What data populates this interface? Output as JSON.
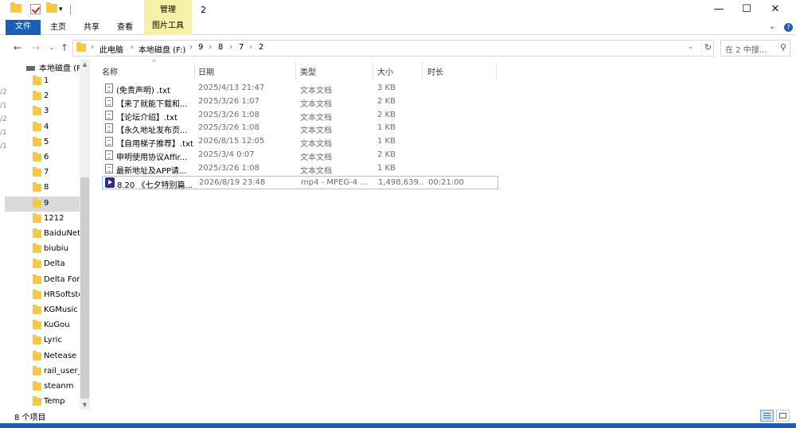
{
  "title_bar": {
    "manage_tab": "管理",
    "window_title": "2",
    "minimize": "—",
    "maximize": "☐",
    "close": "✕"
  },
  "ribbon": {
    "tabs": [
      "文件",
      "主页",
      "共享",
      "查看",
      "图片工具"
    ],
    "expand_glyph": "⌄",
    "help_glyph": "?"
  },
  "address": {
    "crumbs": [
      "此电脑",
      "本地磁盘 (F:)",
      "9",
      "8",
      "7",
      "2"
    ],
    "search_placeholder": "在 2 中搜..."
  },
  "sidebar": {
    "drive_label": "本地磁盘 (F",
    "items": [
      "1",
      "2",
      "3",
      "4",
      "5",
      "6",
      "7",
      "8",
      "9",
      "1212",
      "BaiduNet",
      "biubiu",
      "Delta",
      "Delta Forc",
      "HRSoftsto",
      "KGMusic",
      "KuGou",
      "Lyric",
      "Netease",
      "rail_user_c",
      "steanm",
      "Temp"
    ],
    "selected_index": 8,
    "edge_chars": [
      "/2",
      "/1",
      "/2",
      "/1",
      "/1"
    ]
  },
  "columns": [
    "名称",
    "日期",
    "类型",
    "大小",
    "时长"
  ],
  "files": [
    {
      "icon": "text-file-icon",
      "name": "(免责声明) .txt",
      "date": "2025/4/13 21:47",
      "type": "文本文档",
      "size": "3 KB",
      "duration": ""
    },
    {
      "icon": "text-file-icon",
      "name": "【来了就能下载和...",
      "date": "2025/3/26 1:07",
      "type": "文本文档",
      "size": "2 KB",
      "duration": ""
    },
    {
      "icon": "text-file-icon",
      "name": "【论坛介绍】.txt",
      "date": "2025/3/26 1:08",
      "type": "文本文档",
      "size": "2 KB",
      "duration": ""
    },
    {
      "icon": "text-file-icon",
      "name": "【永久地址发布页...",
      "date": "2025/3/26 1:08",
      "type": "文本文档",
      "size": "1 KB",
      "duration": ""
    },
    {
      "icon": "text-file-icon",
      "name": "【自用梯子推荐】.txt",
      "date": "2026/8/15 12:05",
      "type": "文本文档",
      "size": "1 KB",
      "duration": ""
    },
    {
      "icon": "text-file-icon",
      "name": "申明使用协议Affir...",
      "date": "2025/3/4 0:07",
      "type": "文本文档",
      "size": "2 KB",
      "duration": ""
    },
    {
      "icon": "text-file-icon",
      "name": "最新地址及APP请...",
      "date": "2025/3/26 1:08",
      "type": "文本文档",
      "size": "1 KB",
      "duration": ""
    },
    {
      "icon": "video-file-icon",
      "name": "8.20 《七夕特别篇...",
      "date": "2026/8/19 23:48",
      "type": "mp4 - MPEG-4 ...",
      "size": "1,498,639...",
      "duration": "00:21:00"
    }
  ],
  "selected_file_index": 7,
  "status": {
    "item_count": "8 个项目"
  },
  "colors": {
    "accent": "#1a5fb4",
    "manage_tab": "#f5f2a8",
    "folder": "#f8c844"
  }
}
